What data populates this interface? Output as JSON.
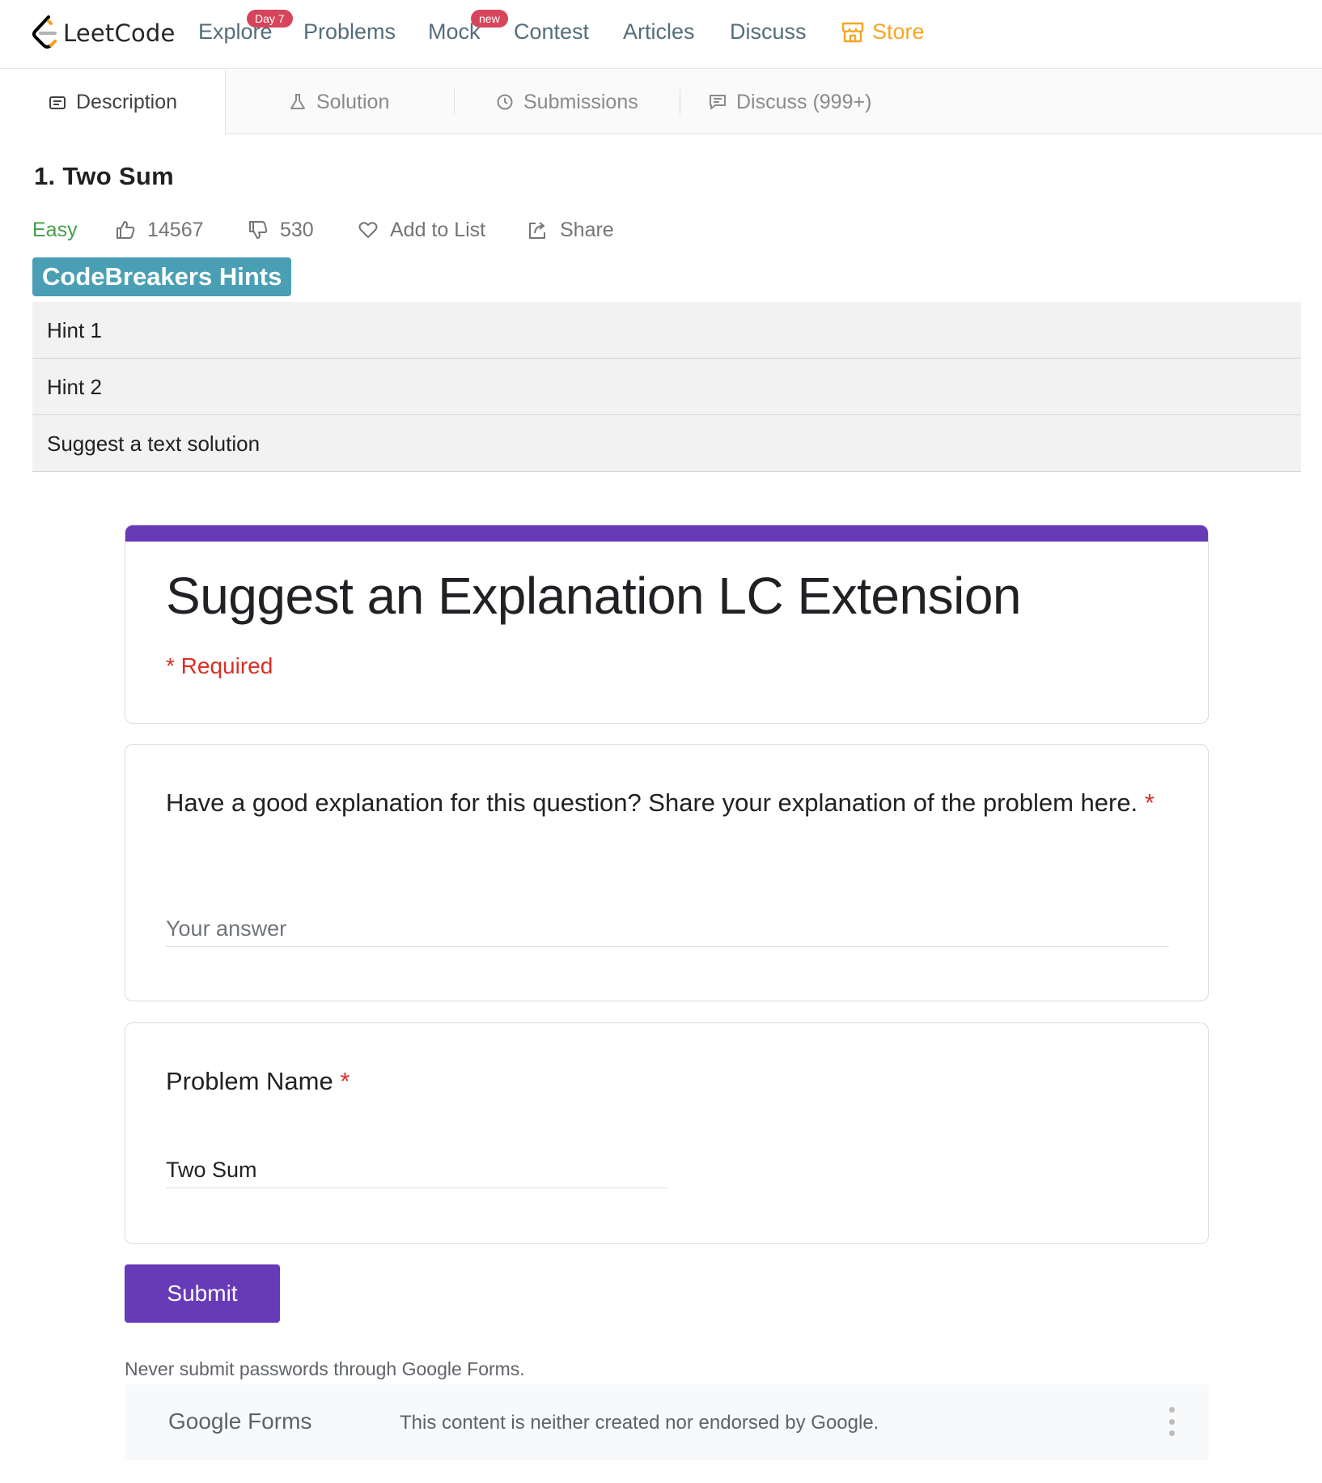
{
  "nav": {
    "logo_text": "LeetCode",
    "items": [
      {
        "label": "Explore",
        "badge": "Day 7"
      },
      {
        "label": "Problems"
      },
      {
        "label": "Mock",
        "badge": "new"
      },
      {
        "label": "Contest"
      },
      {
        "label": "Articles"
      },
      {
        "label": "Discuss"
      },
      {
        "label": "Store",
        "icon": "store-icon"
      }
    ],
    "colors": {
      "text": "#546e7a",
      "store": "#f5a623",
      "badge": "#d6455b"
    }
  },
  "tabs": [
    {
      "label": "Description",
      "icon": "description-icon",
      "active": true
    },
    {
      "label": "Solution",
      "icon": "flask-icon"
    },
    {
      "label": "Submissions",
      "icon": "clock-icon"
    },
    {
      "label": "Discuss (999+)",
      "icon": "comment-icon"
    }
  ],
  "problem": {
    "title": "1. Two Sum",
    "difficulty": "Easy",
    "likes": "14567",
    "dislikes": "530",
    "add_to_list": "Add to List",
    "share": "Share",
    "difficulty_color": "#43a047"
  },
  "hints": {
    "label": "CodeBreakers Hints",
    "label_color": "#4a9fb5",
    "rows": [
      "Hint 1",
      "Hint 2",
      "Suggest a text solution"
    ]
  },
  "form": {
    "title": "Suggest an Explanation LC Extension",
    "required_note": "* Required",
    "accent": "#673ab7",
    "question1": {
      "text": "Have a good explanation for this question? Share your explanation of the problem here.",
      "required_mark": "*",
      "placeholder": "Your answer",
      "value": ""
    },
    "question2": {
      "text": "Problem Name",
      "required_mark": "*",
      "value": "Two Sum"
    },
    "submit_label": "Submit",
    "disclaimer": "Never submit passwords through Google Forms.",
    "footer": {
      "brand_google": "Google",
      "brand_forms": "Forms",
      "note": "This content is neither created nor endorsed by Google."
    }
  }
}
